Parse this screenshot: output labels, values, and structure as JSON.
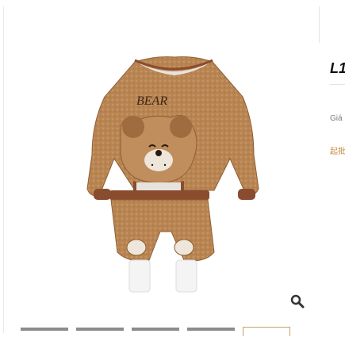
{
  "product": {
    "title": "L1",
    "price_label": "Giá",
    "cn_label": "起批",
    "image_text": "BEAR",
    "image_colors": {
      "fleece": "#b88552",
      "fleece_dark": "#8f5e33",
      "cuff": "#8a4c2e",
      "collar": "#e7e2dc",
      "shoes": "#f4f4f4"
    }
  },
  "gallery": {
    "zoom_icon": "magnifier-icon",
    "thumbnails": [
      {
        "active": false
      },
      {
        "active": false
      },
      {
        "active": false
      },
      {
        "active": false
      },
      {
        "active": true
      }
    ]
  },
  "colors": {
    "accent": "#c9a06a",
    "thumb": "#8c8c8c",
    "title": "#111111"
  }
}
